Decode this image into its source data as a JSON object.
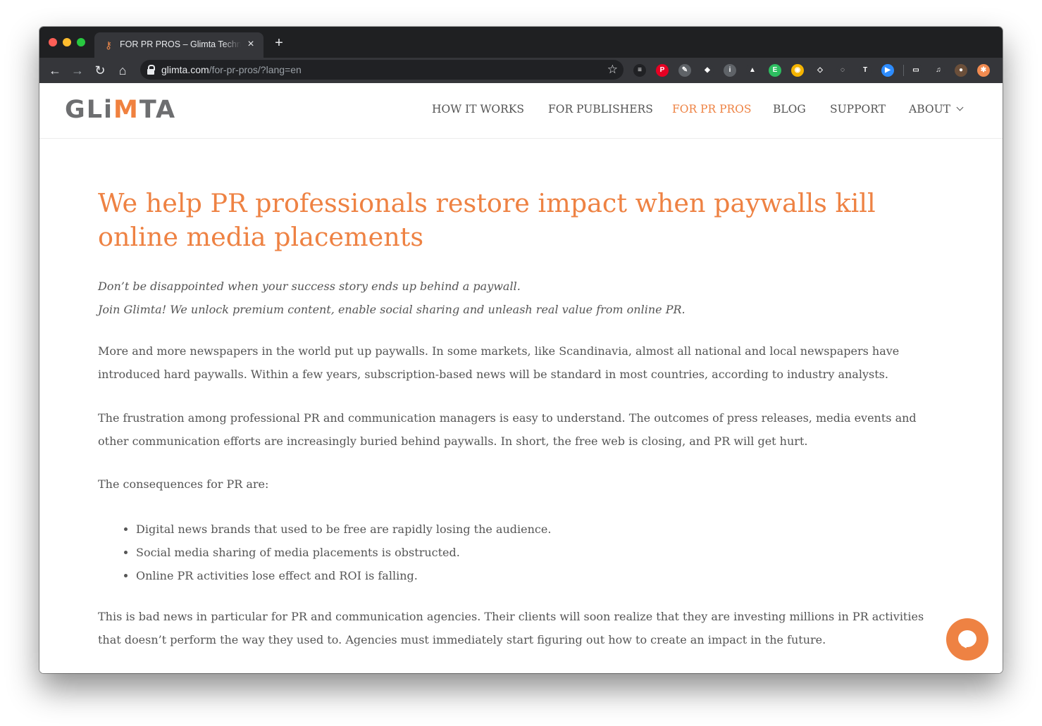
{
  "browser": {
    "tab_title": "FOR PR PROS – Glimta Technologies",
    "tab_close": "×",
    "new_tab": "+",
    "url_host": "glimta.com",
    "url_path": "/for-pr-pros/?lang=en",
    "back": "←",
    "forward": "→",
    "reload": "↻",
    "home": "⌂",
    "bookmark_star": "☆",
    "extensions": [
      {
        "name": "buffer-icon",
        "glyph": "≡",
        "color": "#202124"
      },
      {
        "name": "pinterest-icon",
        "glyph": "P",
        "color": "#e60023"
      },
      {
        "name": "color-picker-icon",
        "glyph": "✎",
        "color": "#5f6368"
      },
      {
        "name": "gem-icon",
        "glyph": "◆",
        "color": "#35363a"
      },
      {
        "name": "info-icon",
        "glyph": "i",
        "color": "#5f6368"
      },
      {
        "name": "drive-icon",
        "glyph": "▲",
        "color": "#35363a"
      },
      {
        "name": "evernote-icon",
        "glyph": "E",
        "color": "#2dbe60"
      },
      {
        "name": "chrome-ext-icon",
        "glyph": "◉",
        "color": "#f4b400"
      },
      {
        "name": "dropbox-icon",
        "glyph": "◇",
        "color": "#35363a"
      },
      {
        "name": "globe-icon",
        "glyph": "◌",
        "color": "#35363a"
      },
      {
        "name": "text-ext-icon",
        "glyph": "T",
        "color": "#35363a"
      },
      {
        "name": "zoom-icon",
        "glyph": "▶",
        "color": "#2d8cff"
      },
      {
        "name": "cast-icon",
        "glyph": "▭",
        "color": "#35363a"
      },
      {
        "name": "media-controls-icon",
        "glyph": "♫",
        "color": "#35363a"
      },
      {
        "name": "profile-avatar-icon",
        "glyph": "●",
        "color": "#6b4f3a"
      },
      {
        "name": "extension-orange-icon",
        "glyph": "✱",
        "color": "#f28b50"
      }
    ]
  },
  "site": {
    "logo_pre": "GLi",
    "logo_m": "M",
    "logo_post": "TA",
    "nav": [
      {
        "label": "HOW IT WORKS"
      },
      {
        "label": "FOR PUBLISHERS"
      },
      {
        "label": "FOR PR PROS"
      },
      {
        "label": "BLOG"
      },
      {
        "label": "SUPPORT"
      },
      {
        "label": "ABOUT"
      }
    ],
    "brand_color": "#ee8243"
  },
  "content": {
    "heading": "We help PR professionals restore impact when paywalls kill online media placements",
    "intro_1": "Don’t be disappointed when your success story ends up behind a paywall.",
    "intro_2": "Join Glimta! We unlock premium content, enable social sharing and unleash real value from online PR.",
    "para_1_line_1": "More and more newspapers in the world put up paywalls. In some markets, like Scandinavia, almost all national and local newspapers have",
    "para_1_line_2": "introduced hard paywalls. Within a few years, subscription-based news will be standard in most countries, according to industry analysts.",
    "para_2_line_1": "The frustration among professional PR and communication managers is easy to understand. The outcomes of press releases, media events and",
    "para_2_line_2": "other communication efforts are increasingly buried behind paywalls. In short, the free web is closing, and PR will get hurt.",
    "para_3": "The consequences for PR are:",
    "bullets": [
      "Digital news brands that used to be free are rapidly losing the audience.",
      "Social media sharing of media placements is obstructed.",
      "Online PR activities lose effect and ROI is falling."
    ],
    "para_4_line_1": "This is bad news in particular for PR and communication agencies. Their clients will soon realize that they are investing millions in PR activities",
    "para_4_line_2": "that doesn’t perform the way they used to. Agencies must immediately start figuring out how to create an impact in the future."
  }
}
